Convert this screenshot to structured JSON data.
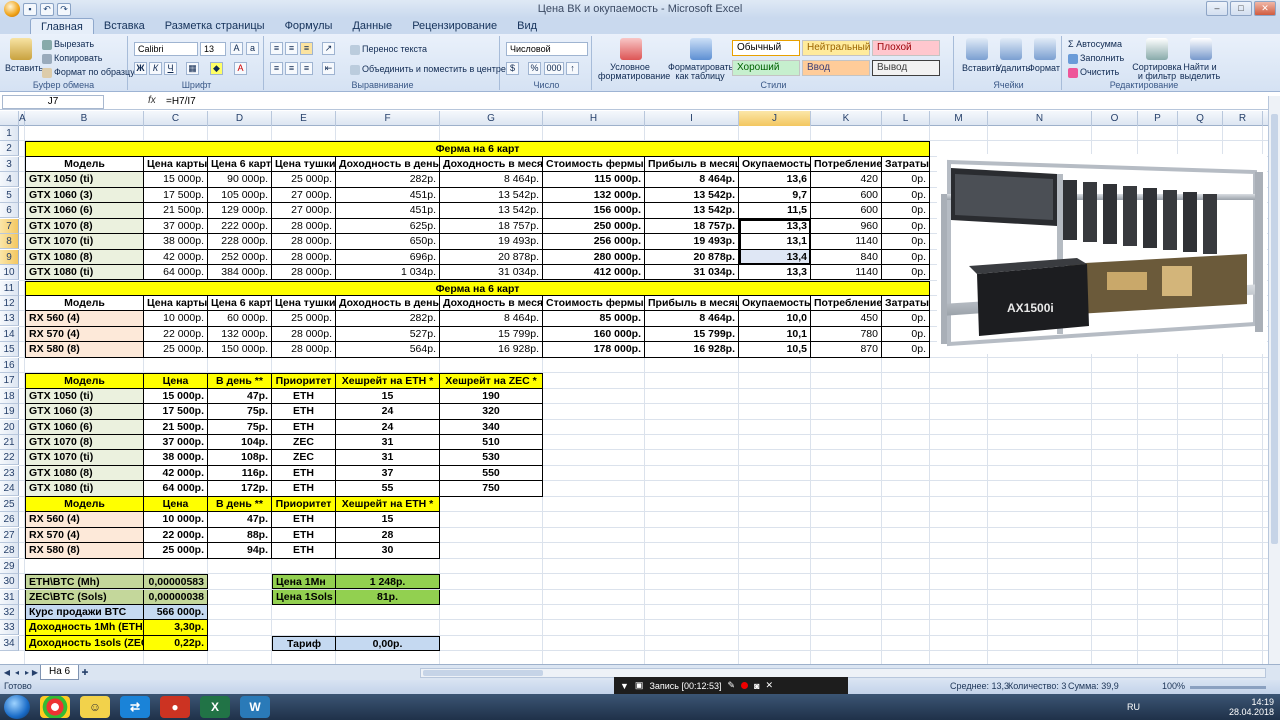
{
  "window": {
    "title": "Цена ВК и окупаемость - Microsoft Excel"
  },
  "tabs": [
    "Главная",
    "Вставка",
    "Разметка страницы",
    "Формулы",
    "Данные",
    "Рецензирование",
    "Вид"
  ],
  "ribbon": {
    "clipboard": {
      "label": "Буфер обмена",
      "paste": "Вставить",
      "cut": "Вырезать",
      "copy": "Копировать",
      "format_painter": "Формат по образцу"
    },
    "font": {
      "label": "Шрифт",
      "name": "Calibri",
      "size": "13",
      "bold": "Ж",
      "italic": "К",
      "underline": "Ч"
    },
    "alignment": {
      "label": "Выравнивание",
      "wrap": "Перенос текста",
      "merge": "Объединить и поместить в центре"
    },
    "number": {
      "label": "Число",
      "format": "Числовой",
      "percent": "%",
      "thousands": "000"
    },
    "styles": {
      "label": "Стили",
      "cond_format": "Условное форматирование",
      "table_format": "Форматировать как таблицу",
      "normal": "Обычный",
      "neutral": "Нейтральный",
      "bad": "Плохой",
      "good": "Хороший",
      "input": "Ввод",
      "output": "Вывод",
      "cell_styles": "Стили ячеек"
    },
    "cells": {
      "label": "Ячейки",
      "insert": "Вставить",
      "delete": "Удалить",
      "format": "Формат"
    },
    "editing": {
      "label": "Редактирование",
      "autosum": "Автосумма",
      "fill": "Заполнить",
      "clear": "Очистить",
      "sort": "Сортировка и фильтр",
      "find": "Найти и выделить"
    }
  },
  "formula_bar": {
    "name_box": "J7",
    "fx": "fx",
    "formula": "=H7/I7"
  },
  "columns": [
    "A",
    "B",
    "C",
    "D",
    "E",
    "F",
    "G",
    "H",
    "I",
    "J",
    "K",
    "L",
    "M",
    "N",
    "O",
    "P",
    "Q",
    "R"
  ],
  "selected_column": "J",
  "rows": [
    "1",
    "2",
    "3",
    "4",
    "5",
    "6",
    "7",
    "8",
    "9",
    "10",
    "11",
    "12",
    "13",
    "14",
    "15",
    "16",
    "17",
    "18",
    "19",
    "20",
    "21",
    "22",
    "23",
    "24",
    "25",
    "26",
    "27",
    "28",
    "29",
    "30",
    "31",
    "32",
    "33",
    "34"
  ],
  "selected_rows": [
    "7",
    "8",
    "9"
  ],
  "table1": {
    "title": "Ферма на 6 карт",
    "headers": [
      "Модель",
      "Цена карты",
      "Цена 6 карт",
      "Цена тушки",
      "Доходность в день",
      "Доходность в месяц",
      "Стоимость фермы",
      "Прибыль в месяц",
      "Окупаемость",
      "Потребление",
      "Затраты"
    ],
    "rows": [
      [
        "GTX 1050 (ti)",
        "15 000р.",
        "90 000р.",
        "25 000р.",
        "282р.",
        "8 464р.",
        "115 000р.",
        "8 464р.",
        "13,6",
        "420",
        "0р."
      ],
      [
        "GTX 1060 (3)",
        "17 500р.",
        "105 000р.",
        "27 000р.",
        "451р.",
        "13 542р.",
        "132 000р.",
        "13 542р.",
        "9,7",
        "600",
        "0р."
      ],
      [
        "GTX 1060 (6)",
        "21 500р.",
        "129 000р.",
        "27 000р.",
        "451р.",
        "13 542р.",
        "156 000р.",
        "13 542р.",
        "11,5",
        "600",
        "0р."
      ],
      [
        "GTX 1070 (8)",
        "37 000р.",
        "222 000р.",
        "28 000р.",
        "625р.",
        "18 757р.",
        "250 000р.",
        "18 757р.",
        "13,3",
        "960",
        "0р."
      ],
      [
        "GTX 1070 (ti)",
        "38 000р.",
        "228 000р.",
        "28 000р.",
        "650р.",
        "19 493р.",
        "256 000р.",
        "19 493р.",
        "13,1",
        "1140",
        "0р."
      ],
      [
        "GTX 1080 (8)",
        "42 000р.",
        "252 000р.",
        "28 000р.",
        "696р.",
        "20 878р.",
        "280 000р.",
        "20 878р.",
        "13,4",
        "840",
        "0р."
      ],
      [
        "GTX 1080 (ti)",
        "64 000р.",
        "384 000р.",
        "28 000р.",
        "1 034р.",
        "31 034р.",
        "412 000р.",
        "31 034р.",
        "13,3",
        "1140",
        "0р."
      ]
    ]
  },
  "table2": {
    "title": "Ферма на 6 карт",
    "headers": [
      "Модель",
      "Цена карты",
      "Цена 6 карт",
      "Цена тушки",
      "Доходность в день",
      "Доходность в месяц",
      "Стоимость фермы",
      "Прибыль в месяц",
      "Окупаемость",
      "Потребление",
      "Затраты"
    ],
    "rows": [
      [
        "RX 560 (4)",
        "10 000р.",
        "60 000р.",
        "25 000р.",
        "282р.",
        "8 464р.",
        "85 000р.",
        "8 464р.",
        "10,0",
        "450",
        "0р."
      ],
      [
        "RX 570 (4)",
        "22 000р.",
        "132 000р.",
        "28 000р.",
        "527р.",
        "15 799р.",
        "160 000р.",
        "15 799р.",
        "10,1",
        "780",
        "0р."
      ],
      [
        "RX 580 (8)",
        "25 000р.",
        "150 000р.",
        "28 000р.",
        "564р.",
        "16 928р.",
        "178 000р.",
        "16 928р.",
        "10,5",
        "870",
        "0р."
      ]
    ]
  },
  "table3": {
    "headers": [
      "Модель",
      "Цена",
      "В день **",
      "Приоритет",
      "Хешрейт на ETH *",
      "Хешрейт на ZEC *"
    ],
    "rows": [
      [
        "GTX 1050 (ti)",
        "15 000р.",
        "47р.",
        "ETH",
        "15",
        "190"
      ],
      [
        "GTX 1060 (3)",
        "17 500р.",
        "75р.",
        "ETH",
        "24",
        "320"
      ],
      [
        "GTX 1060 (6)",
        "21 500р.",
        "75р.",
        "ETH",
        "24",
        "340"
      ],
      [
        "GTX 1070 (8)",
        "37 000р.",
        "104р.",
        "ZEC",
        "31",
        "510"
      ],
      [
        "GTX 1070 (ti)",
        "38 000р.",
        "108р.",
        "ZEC",
        "31",
        "530"
      ],
      [
        "GTX 1080 (8)",
        "42 000р.",
        "116р.",
        "ETH",
        "37",
        "550"
      ],
      [
        "GTX 1080 (ti)",
        "64 000р.",
        "172р.",
        "ETH",
        "55",
        "750"
      ]
    ]
  },
  "table4": {
    "headers": [
      "Модель",
      "Цена",
      "В день **",
      "Приоритет",
      "Хешрейт на ETH *"
    ],
    "rows": [
      [
        "RX 560 (4)",
        "10 000р.",
        "47р.",
        "ETH",
        "15"
      ],
      [
        "RX 570 (4)",
        "22 000р.",
        "88р.",
        "ETH",
        "28"
      ],
      [
        "RX 580 (8)",
        "25 000р.",
        "94р.",
        "ETH",
        "30"
      ]
    ]
  },
  "rates": {
    "eth_btc_label": "ETH\\BTC (Mh)",
    "eth_btc": "0,00000583",
    "zec_btc_label": "ZEC\\BTC (Sols)",
    "zec_btc": "0,00000038",
    "btc_label": "Курс продажи BTC",
    "btc": "566 000р.",
    "eth_income_label": "Доходность 1Mh (ETH)",
    "eth_income": "3,30р.",
    "zec_income_label": "Доходность 1sols (ZEC)",
    "zec_income": "0,22р.",
    "price_mh_label": "Цена 1Мн",
    "price_mh": "1 248р.",
    "price_sols_label": "Цена 1Sols",
    "price_sols": "81р.",
    "tariff_label": "Тариф",
    "tariff": "0,00р."
  },
  "rig_image": {
    "psu_label": "AX1500i"
  },
  "sheet_tab": "На 6",
  "status": {
    "ready": "Готово",
    "average": "Среднее: 13,3",
    "count": "Количество: 3",
    "sum": "Сумма: 39,9",
    "zoom": "100%"
  },
  "recorder": {
    "label": "Запись [00:12:53]"
  },
  "taskbar": {
    "lang": "RU",
    "time": "14:19",
    "date": "28.04.2018"
  }
}
